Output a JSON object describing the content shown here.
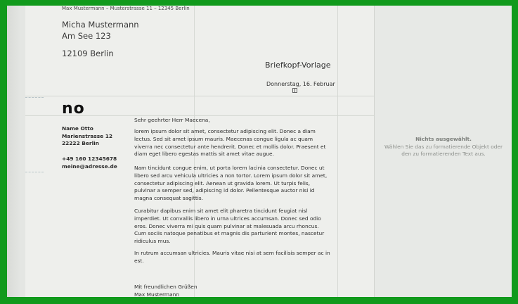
{
  "letterhead": {
    "sender_line": "Max Mustermann – Musterstrasse 11 – 12345 Berlin",
    "recipient_name": "Micha Mustermann",
    "recipient_street": "Am See 123",
    "recipient_city": "12109 Berlin",
    "template_title": "Briefkopf-Vorlage",
    "date": "Donnerstag, 16. Februar"
  },
  "sidebar": {
    "logo": "no",
    "name": "Name Otto",
    "street": "Marienstrasse 12",
    "city": "22222 Berlin",
    "phone": "+49 160 12345678",
    "email": "meine@adresse.de"
  },
  "letter": {
    "salutation": "Sehr geehrter Herr Maecena,",
    "paragraphs": [
      "lorem ipsum dolor sit amet, consectetur adipiscing elit. Donec a diam lectus. Sed sit amet ipsum mauris. Maecenas congue ligula ac quam viverra nec consectetur ante hendrerit. Donec et mollis dolor. Praesent et diam eget libero egestas mattis sit amet vitae augue.",
      "Nam tincidunt congue enim, ut porta lorem lacinia consectetur. Donec ut libero sed arcu vehicula ultricies a non tortor. Lorem ipsum dolor sit amet, consectetur adipiscing elit. Aenean ut gravida lorem. Ut turpis felis, pulvinar a semper sed, adipiscing id dolor. Pellentesque auctor nisi id magna consequat sagittis.",
      "Curabitur dapibus enim sit amet elit pharetra tincidunt feugiat nisl imperdiet. Ut convallis libero in urna ultrices accumsan. Donec sed odio eros. Donec viverra mi quis quam pulvinar at malesuada arcu rhoncus. Cum sociis natoque penatibus et magnis dis parturient montes, nascetur ridiculus mus.",
      "In rutrum accumsan ultricies. Mauris vitae nisi at sem facilisis semper ac in est."
    ],
    "closing": "Mit freundlichen Grüßen",
    "signature": "Max Mustermann"
  },
  "inspector": {
    "title": "Nichts ausgewählt.",
    "hint": "Wählen Sie das zu formatierende Objekt oder den zu formatierenden Text aus."
  },
  "colors": {
    "border": "#119a1c",
    "page": "#eeefec",
    "panel": "#e7e9e6"
  }
}
